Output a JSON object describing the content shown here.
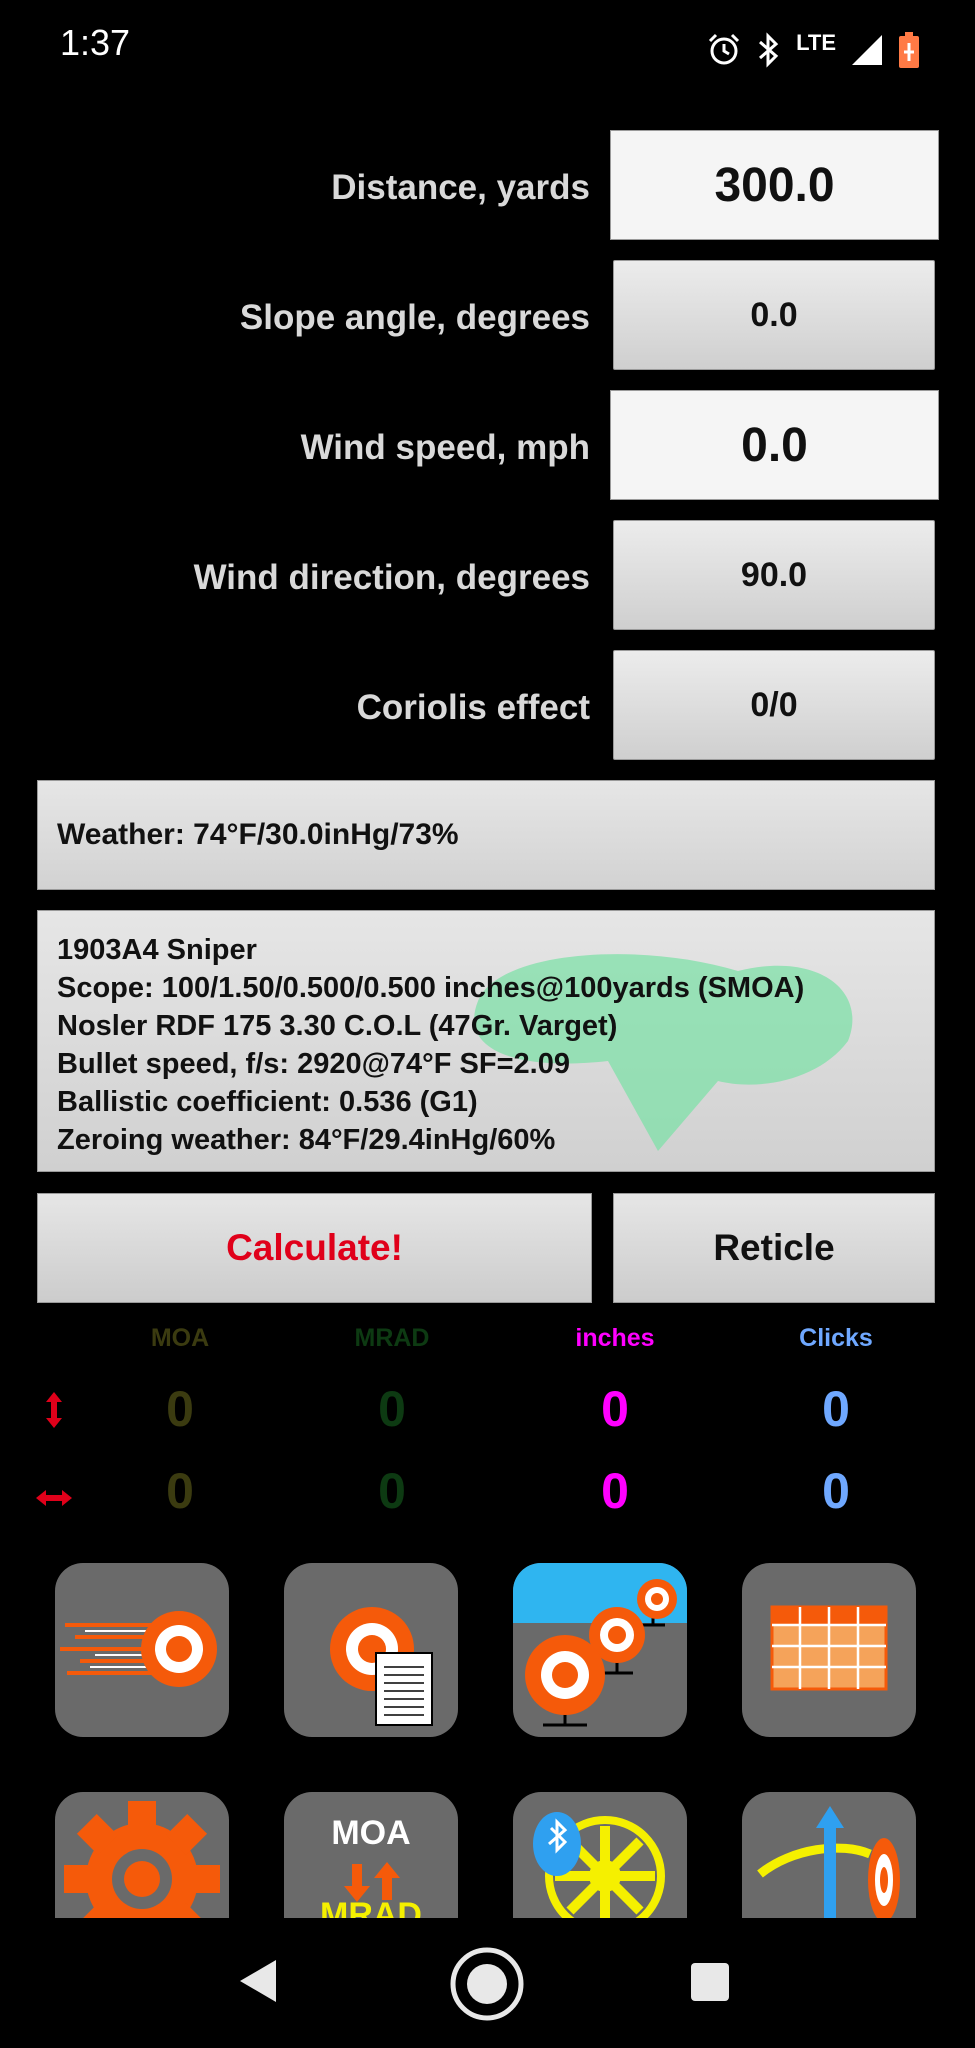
{
  "status_bar": {
    "time": "1:37",
    "network": "LTE"
  },
  "inputs": [
    {
      "label": "Distance, yards",
      "value": "300.0"
    },
    {
      "label": "Slope angle, degrees",
      "value": "0.0"
    },
    {
      "label": "Wind speed, mph",
      "value": "0.0"
    },
    {
      "label": "Wind direction, degrees",
      "value": "90.0"
    },
    {
      "label": "Coriolis effect",
      "value": "0/0"
    }
  ],
  "weather": "Weather: 74°F/30.0inHg/73%",
  "profile": {
    "lines": [
      "1903A4 Sniper",
      "Scope: 100/1.50/0.500/0.500 inches@100yards (SMOA)",
      "Nosler RDF 175 3.30 C.O.L (47Gr. Varget)",
      "Bullet speed, f/s: 2920@74°F SF=2.09",
      "Ballistic coefficient: 0.536 (G1)",
      "Zeroing weather: 84°F/29.4inHg/60%"
    ]
  },
  "buttons": {
    "calculate": "Calculate!",
    "reticle": "Reticle"
  },
  "results": {
    "columns": [
      "MOA",
      "MRAD",
      "inches",
      "Clicks"
    ],
    "vertical": [
      "0",
      "0",
      "0",
      "0"
    ],
    "horizontal": [
      "0",
      "0",
      "0",
      "0"
    ]
  },
  "tiles": {
    "moa_mrad_top": "MOA",
    "moa_mrad_bottom": "MRAD"
  },
  "colors": {
    "moa": "#3b3b10",
    "mrad": "#0d3a12",
    "inches": "#ff00ff",
    "clicks": "#6fa8ff",
    "calculate": "#e0001a",
    "accent_orange": "#f55a0a",
    "arrow_red": "#e0001a"
  }
}
